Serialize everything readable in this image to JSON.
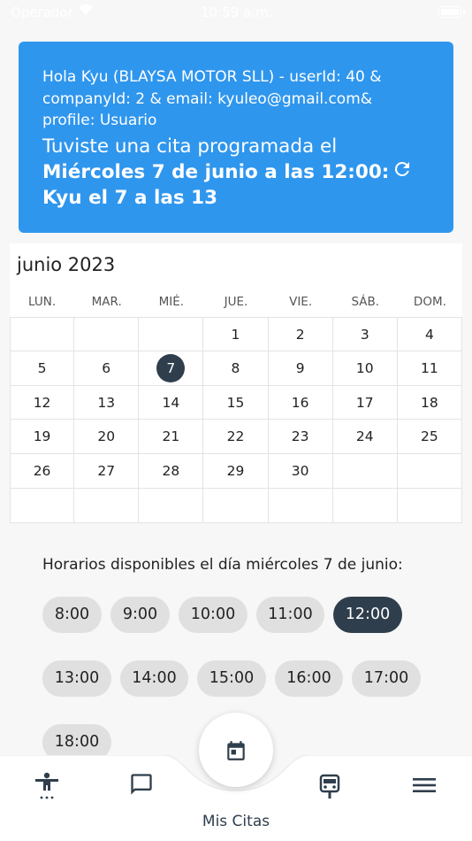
{
  "status_bar": {
    "carrier": "Operador",
    "time": "10:59 a.m."
  },
  "banner": {
    "user_info": "Hola Kyu (BLAYSA MOTOR SLL) - userId: 40 & companyId: 2 & email: kyuleo@gmail.com& profile: Usuario",
    "appointment_prefix": "Tuviste una cita programada el",
    "appointment_detail": "Miércoles 7 de junio a las 12:00: Kyu el 7 a las 13",
    "refresh_icon": "refresh-icon"
  },
  "calendar": {
    "month_title": "junio 2023",
    "weekdays": [
      "LUN.",
      "MAR.",
      "MIÉ.",
      "JUE.",
      "VIE.",
      "SÁB.",
      "DOM."
    ],
    "selected_day": "7",
    "weeks": [
      [
        "",
        "",
        "",
        "1",
        "2",
        "3",
        "4"
      ],
      [
        "5",
        "6",
        "7",
        "8",
        "9",
        "10",
        "11"
      ],
      [
        "12",
        "13",
        "14",
        "15",
        "16",
        "17",
        "18"
      ],
      [
        "19",
        "20",
        "21",
        "22",
        "23",
        "24",
        "25"
      ],
      [
        "26",
        "27",
        "28",
        "29",
        "30",
        "",
        ""
      ],
      [
        "",
        "",
        "",
        "",
        "",
        "",
        ""
      ]
    ]
  },
  "availability": {
    "title": "Horarios disponibles el día miércoles 7 de junio:",
    "slots": [
      "8:00",
      "9:00",
      "10:00",
      "11:00",
      "12:00",
      "13:00",
      "14:00",
      "15:00",
      "16:00",
      "17:00",
      "18:00"
    ],
    "selected": "12:00"
  },
  "bottom_nav": {
    "items": [
      "accessibility-icon",
      "chat-icon",
      "calendar-icon",
      "car-icon",
      "menu-icon"
    ],
    "active_label": "Mis Citas"
  },
  "colors": {
    "accent_blue": "#2f96ee",
    "dark": "#2f3e4c",
    "chip_bg": "#e0e0e0"
  }
}
